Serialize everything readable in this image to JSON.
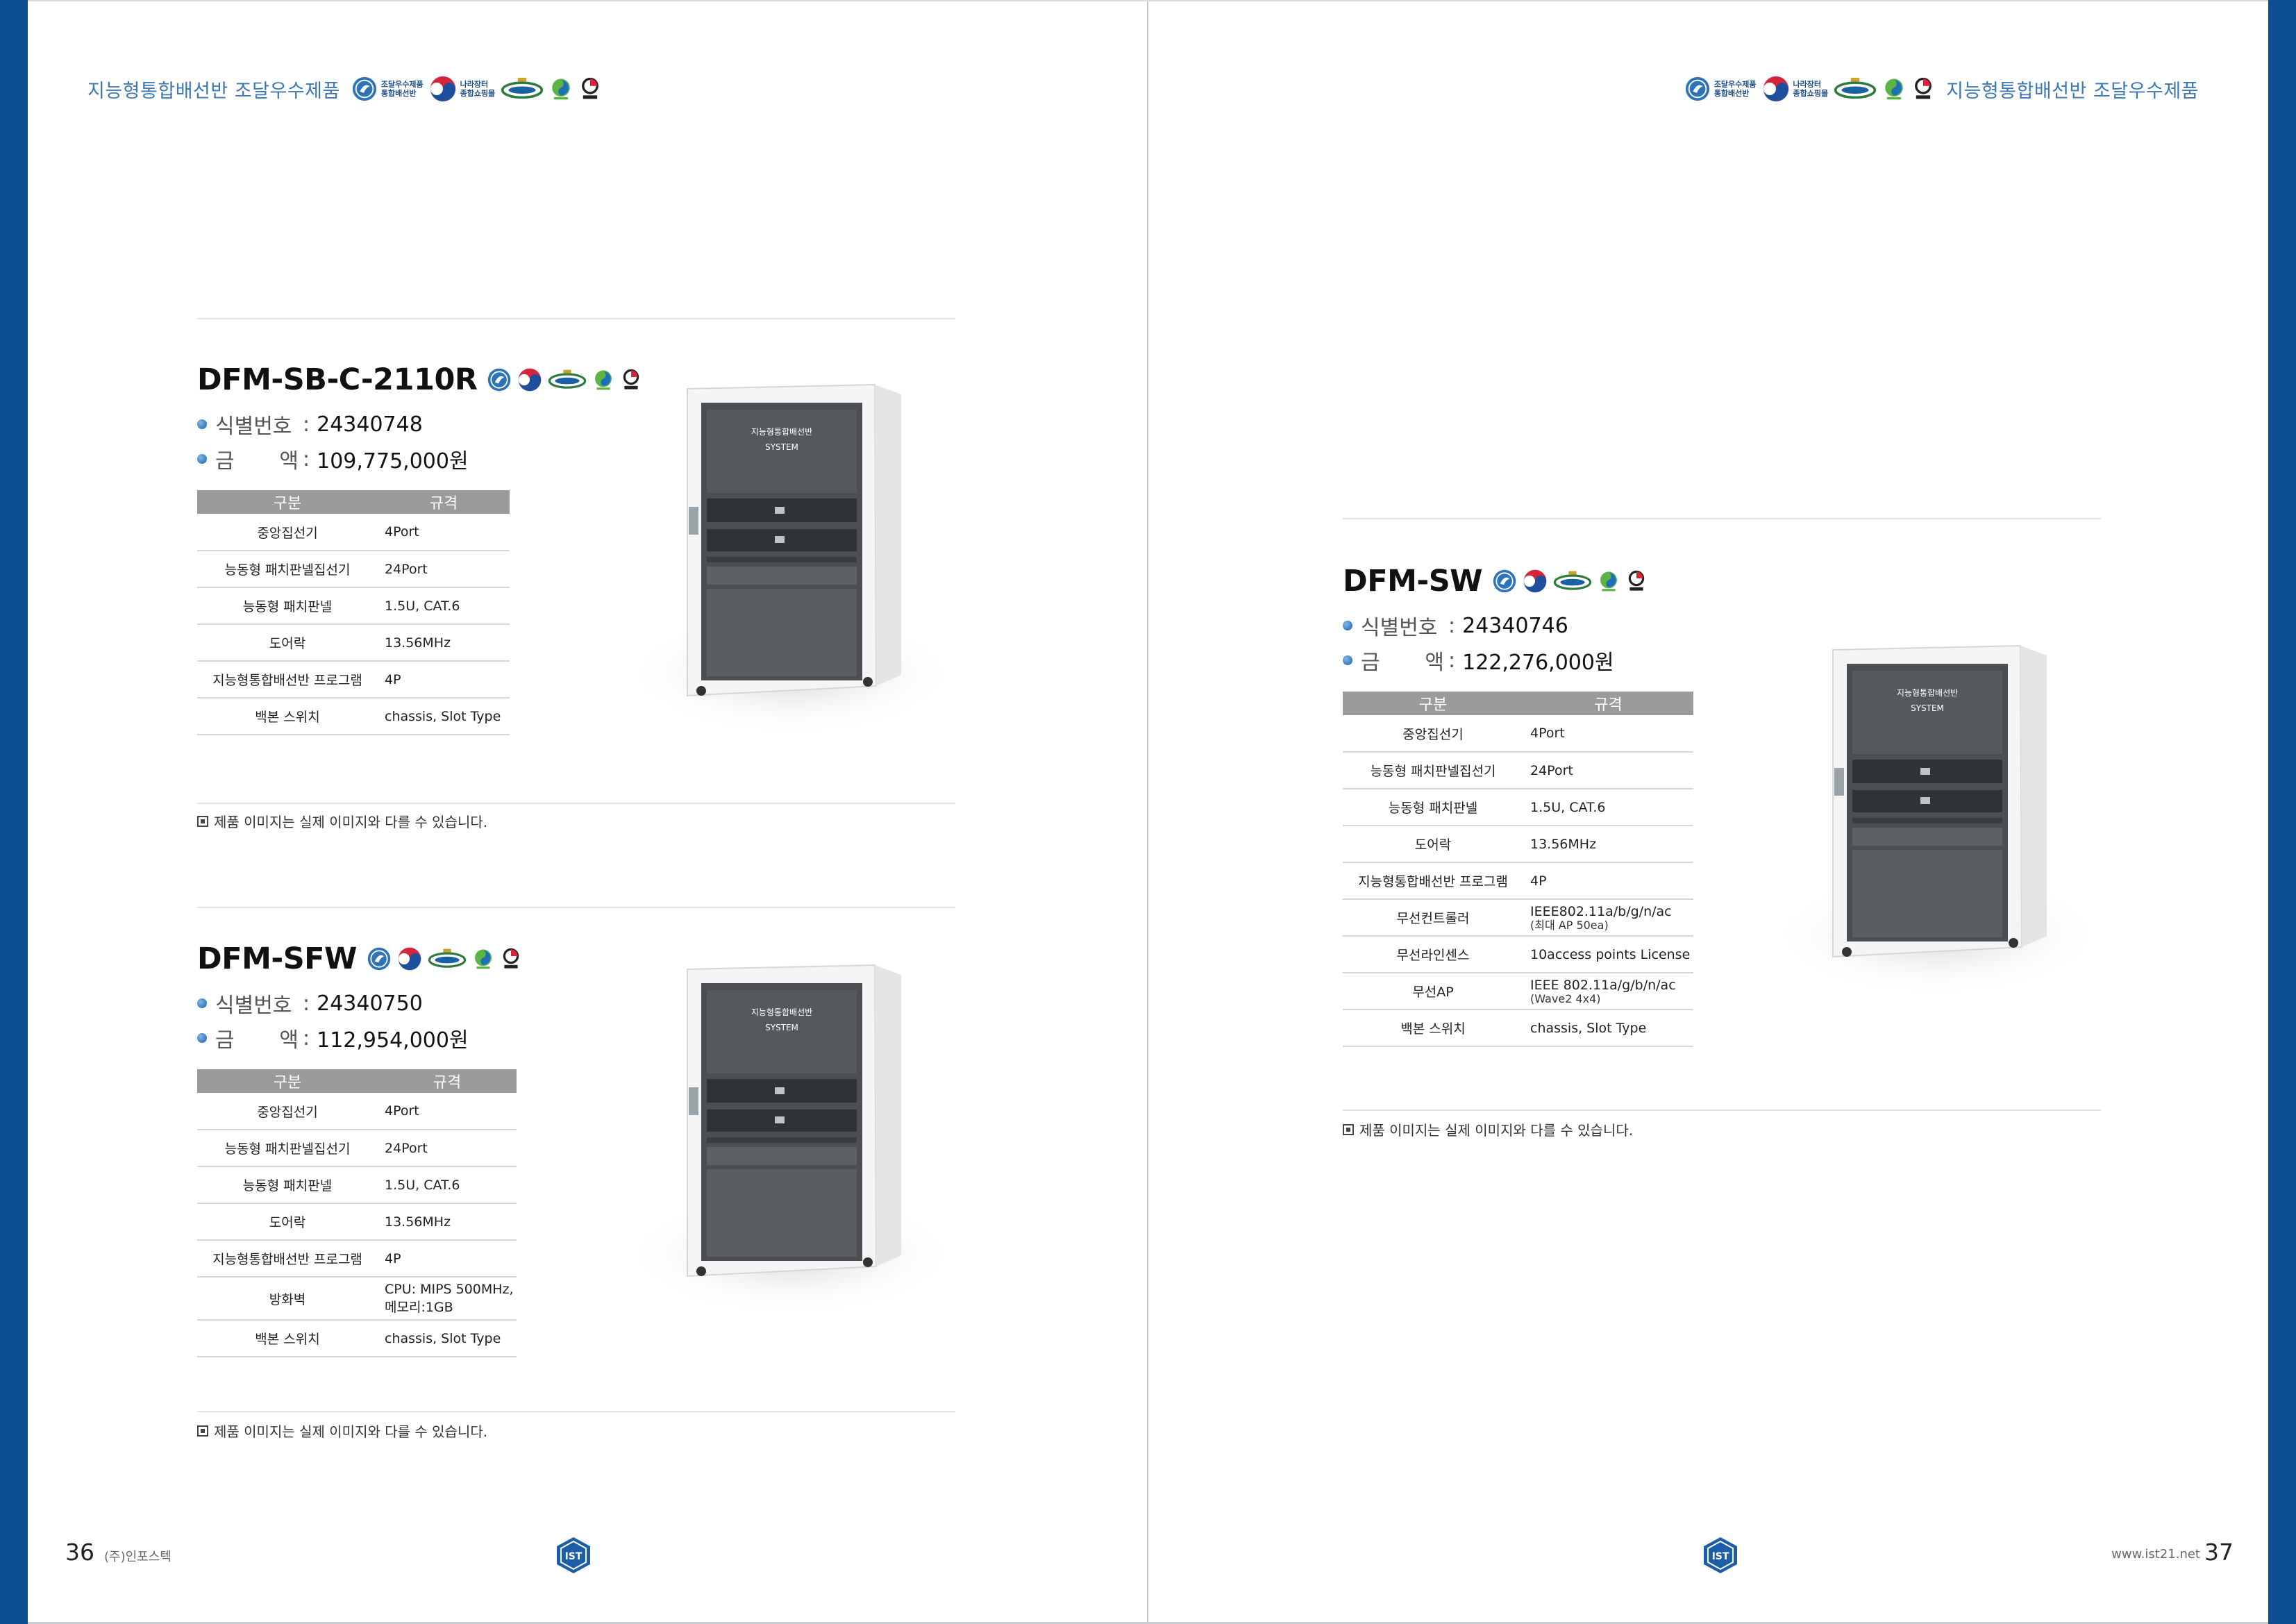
{
  "header": {
    "title": "지능형통합배선반 조달우수제품",
    "marks": {
      "procurement": "조달우수제품\n통합배선반",
      "narajangteo": "나라장터\n종합쇼핑몰",
      "certification_lettering": "1등급",
      "patent_lettering": "특허"
    }
  },
  "cabinet_label": {
    "line1": "지능형통합배선반",
    "line2": "SYSTEM"
  },
  "spec_headers": {
    "category": "구분",
    "spec": "규격"
  },
  "info_labels": {
    "id": "식별번호",
    "price": "금액",
    "sep": ":"
  },
  "note": "제품 이미지는 실제 이미지와 다를 수 있습니다.",
  "products": [
    {
      "model": "DFM-SB-C-2110R",
      "id_number": "24340748",
      "price": "109,775,000원",
      "specs": [
        {
          "item": "중앙집선기",
          "value": "4Port"
        },
        {
          "item": "능동형 패치판넬집선기",
          "value": "24Port"
        },
        {
          "item": "능동형 패치판넬",
          "value": "1.5U, CAT.6"
        },
        {
          "item": "도어락",
          "value": "13.56MHz"
        },
        {
          "item": "지능형통합배선반 프로그램",
          "value": "4P"
        },
        {
          "item": "백본 스위치",
          "value": "chassis, Slot Type"
        }
      ]
    },
    {
      "model": "DFM-SFW",
      "id_number": "24340750",
      "price": "112,954,000원",
      "specs": [
        {
          "item": "중앙집선기",
          "value": "4Port"
        },
        {
          "item": "능동형 패치판넬집선기",
          "value": "24Port"
        },
        {
          "item": "능동형 패치판넬",
          "value": "1.5U, CAT.6"
        },
        {
          "item": "도어락",
          "value": "13.56MHz"
        },
        {
          "item": "지능형통합배선반 프로그램",
          "value": "4P"
        },
        {
          "item": "방화벽",
          "value": "CPU: MIPS 500MHz,",
          "value2": "메모리:1GB"
        },
        {
          "item": "백본 스위치",
          "value": "chassis, Slot Type"
        }
      ]
    },
    {
      "model": "DFM-SW",
      "id_number": "24340746",
      "price": "122,276,000원",
      "specs": [
        {
          "item": "중앙집선기",
          "value": "4Port"
        },
        {
          "item": "능동형 패치판넬집선기",
          "value": "24Port"
        },
        {
          "item": "능동형 패치판넬",
          "value": "1.5U, CAT.6"
        },
        {
          "item": "도어락",
          "value": "13.56MHz"
        },
        {
          "item": "지능형통합배선반 프로그램",
          "value": "4P"
        },
        {
          "item": "무선컨트롤러",
          "value": "IEEE802.11a/b/g/n/ac",
          "sub": "(최대 AP 50ea)"
        },
        {
          "item": "무선라인센스",
          "value": "10access points License"
        },
        {
          "item": "무선AP",
          "value": "IEEE 802.11a/g/b/n/ac",
          "sub": "(Wave2 4x4)"
        },
        {
          "item": "백본 스위치",
          "value": "chassis, Slot Type"
        }
      ]
    }
  ],
  "footer": {
    "left_page": "36",
    "company": "(주)인포스텍",
    "right_page": "37",
    "website": "www.ist21.net",
    "logo_text": "IST"
  },
  "colors": {
    "brand_blue": "#0b4f92",
    "header_text": "#3d78b6",
    "table_header": "#9b9b9b"
  }
}
